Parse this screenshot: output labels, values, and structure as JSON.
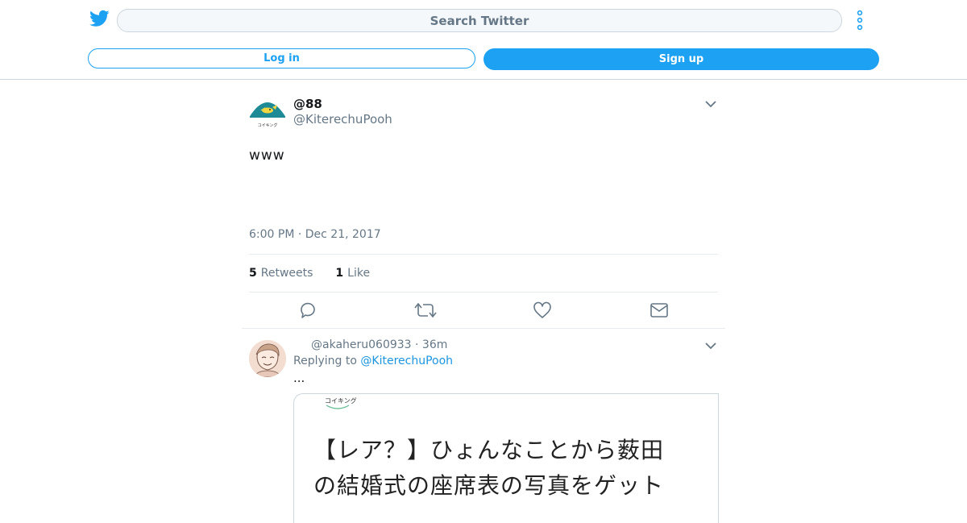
{
  "header": {
    "search_placeholder": "Search Twitter",
    "login_label": "Log in",
    "signup_label": "Sign up",
    "accent": "#1da1f2"
  },
  "tweet": {
    "avatar_label": "コイキング",
    "display_name": "@88",
    "handle": "@KiterechuPooh",
    "text": "www",
    "timestamp": "6:00 PM · Dec 21, 2017",
    "retweets_count": "5",
    "retweets_label": "Retweets",
    "likes_count": "1",
    "likes_label": "Like",
    "icons": [
      "reply-icon",
      "retweet-icon",
      "like-icon",
      "dm-icon"
    ]
  },
  "reply": {
    "meta": "@akaheru060933 · 36m",
    "replying_prefix": "Replying to",
    "replying_to": "@KiterechuPooh",
    "text": "...",
    "media": {
      "small_label": "コイキング",
      "line1": "【レア？】ひょんなことから薮田",
      "line2": "の結婚式の座席表の写真をゲット"
    }
  }
}
